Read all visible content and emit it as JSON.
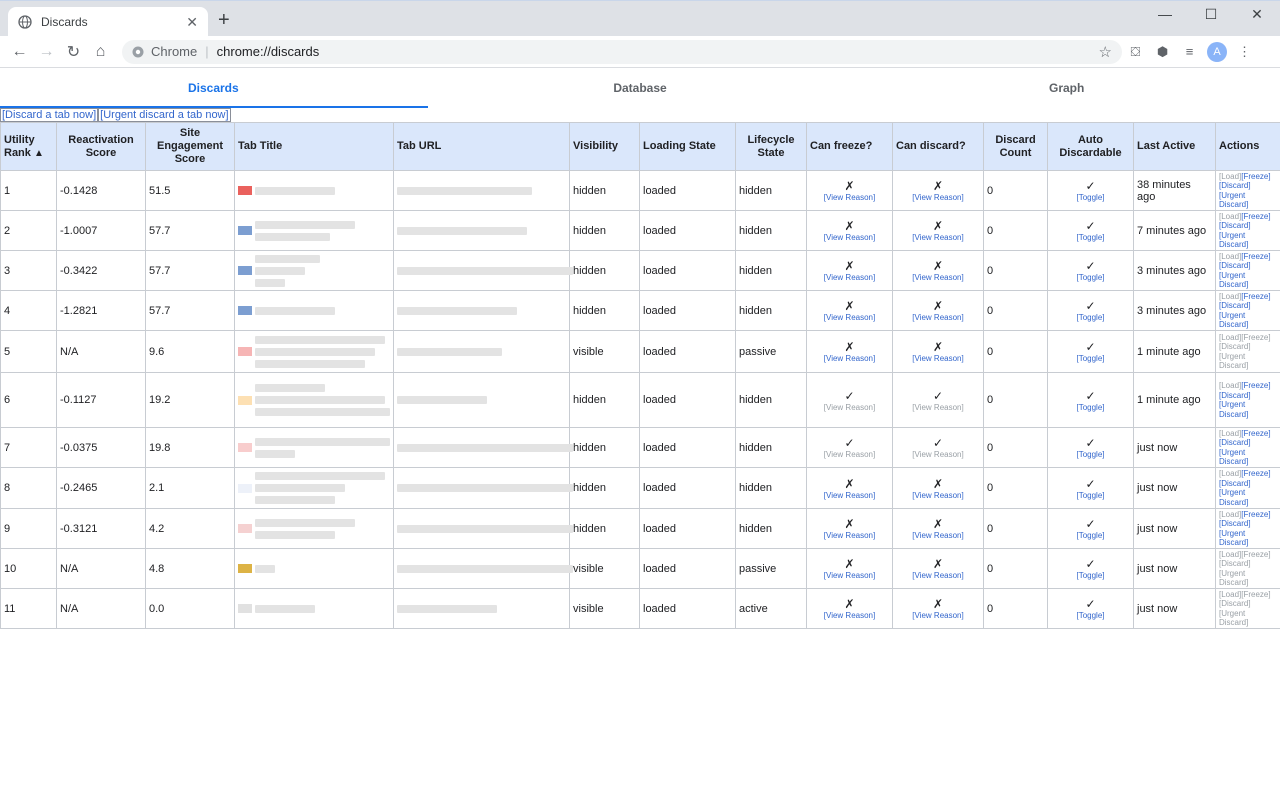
{
  "browser": {
    "tab_title": "Discards",
    "tab_close": "✕",
    "new_tab": "+",
    "window_controls": [
      "—",
      "☐",
      "✕"
    ],
    "omnibox": {
      "chip": "Chrome",
      "separator": "|",
      "url": "chrome://discards"
    },
    "profile_initial": "A"
  },
  "page_tabs": [
    {
      "label": "Discards",
      "active": true
    },
    {
      "label": "Database",
      "active": false
    },
    {
      "label": "Graph",
      "active": false
    }
  ],
  "action_links": {
    "discard": "[Discard a tab now]",
    "urgent": "[Urgent discard a tab now]"
  },
  "columns": [
    "Utility Rank",
    "Reactivation Score",
    "Site Engagement Score",
    "Tab Title",
    "Tab URL",
    "Visibility",
    "Loading State",
    "Lifecycle State",
    "Can freeze?",
    "Can discard?",
    "Discard Count",
    "Auto Discardable",
    "Last Active",
    "Actions"
  ],
  "sort_indicator": "▲",
  "labels": {
    "view_reason": "[View Reason]",
    "toggle": "[Toggle]",
    "load": "[Load]",
    "freeze": "[Freeze]",
    "discard": "[Discard]",
    "urgent": "[Urgent",
    "discard_close": "Discard]"
  },
  "rows": [
    {
      "rank": "1",
      "react": "-0.1428",
      "eng": "51.5",
      "vis": "hidden",
      "load": "loaded",
      "life": "hidden",
      "freeze": "✗",
      "freeze_vr_enabled": true,
      "discard": "✗",
      "discard_vr_enabled": true,
      "count": "0",
      "auto": "✓",
      "last": "38 minutes ago",
      "actions_enabled": true,
      "fav_color": "#e53935"
    },
    {
      "rank": "2",
      "react": "-1.0007",
      "eng": "57.7",
      "vis": "hidden",
      "load": "loaded",
      "life": "hidden",
      "freeze": "✗",
      "freeze_vr_enabled": true,
      "discard": "✗",
      "discard_vr_enabled": true,
      "count": "0",
      "auto": "✓",
      "last": "7 minutes ago",
      "actions_enabled": true,
      "fav_color": "#5b86c5"
    },
    {
      "rank": "3",
      "react": "-0.3422",
      "eng": "57.7",
      "vis": "hidden",
      "load": "loaded",
      "life": "hidden",
      "freeze": "✗",
      "freeze_vr_enabled": true,
      "discard": "✗",
      "discard_vr_enabled": true,
      "count": "0",
      "auto": "✓",
      "last": "3 minutes ago",
      "actions_enabled": true,
      "fav_color": "#5b86c5"
    },
    {
      "rank": "4",
      "react": "-1.2821",
      "eng": "57.7",
      "vis": "hidden",
      "load": "loaded",
      "life": "hidden",
      "freeze": "✗",
      "freeze_vr_enabled": true,
      "discard": "✗",
      "discard_vr_enabled": true,
      "count": "0",
      "auto": "✓",
      "last": "3 minutes ago",
      "actions_enabled": true,
      "fav_color": "#5b86c5"
    },
    {
      "rank": "5",
      "react": "N/A",
      "eng": "9.6",
      "vis": "visible",
      "load": "loaded",
      "life": "passive",
      "freeze": "✗",
      "freeze_vr_enabled": true,
      "discard": "✗",
      "discard_vr_enabled": true,
      "count": "0",
      "auto": "✓",
      "last": "1 minute ago",
      "actions_enabled": false,
      "fav_color": "#f4a3a3"
    },
    {
      "rank": "6",
      "react": "-0.1127",
      "eng": "19.2",
      "vis": "hidden",
      "load": "loaded",
      "life": "hidden",
      "freeze": "✓",
      "freeze_vr_enabled": false,
      "discard": "✓",
      "discard_vr_enabled": false,
      "count": "0",
      "auto": "✓",
      "last": "1 minute ago",
      "actions_enabled": true,
      "fav_color": "#fcd8a0"
    },
    {
      "rank": "7",
      "react": "-0.0375",
      "eng": "19.8",
      "vis": "hidden",
      "load": "loaded",
      "life": "hidden",
      "freeze": "✓",
      "freeze_vr_enabled": false,
      "discard": "✓",
      "discard_vr_enabled": false,
      "count": "0",
      "auto": "✓",
      "last": "just now",
      "actions_enabled": true,
      "fav_color": "#f6c1c1"
    },
    {
      "rank": "8",
      "react": "-0.2465",
      "eng": "2.1",
      "vis": "hidden",
      "load": "loaded",
      "life": "hidden",
      "freeze": "✗",
      "freeze_vr_enabled": true,
      "discard": "✗",
      "discard_vr_enabled": true,
      "count": "0",
      "auto": "✓",
      "last": "just now",
      "actions_enabled": true,
      "fav_color": "#e8eef7"
    },
    {
      "rank": "9",
      "react": "-0.3121",
      "eng": "4.2",
      "vis": "hidden",
      "load": "loaded",
      "life": "hidden",
      "freeze": "✗",
      "freeze_vr_enabled": true,
      "discard": "✗",
      "discard_vr_enabled": true,
      "count": "0",
      "auto": "✓",
      "last": "just now",
      "actions_enabled": true,
      "fav_color": "#f3c6c6"
    },
    {
      "rank": "10",
      "react": "N/A",
      "eng": "4.8",
      "vis": "visible",
      "load": "loaded",
      "life": "passive",
      "freeze": "✗",
      "freeze_vr_enabled": true,
      "discard": "✗",
      "discard_vr_enabled": true,
      "count": "0",
      "auto": "✓",
      "last": "just now",
      "actions_enabled": false,
      "fav_color": "#d4a017"
    },
    {
      "rank": "11",
      "react": "N/A",
      "eng": "0.0",
      "vis": "visible",
      "load": "loaded",
      "life": "active",
      "freeze": "✗",
      "freeze_vr_enabled": true,
      "discard": "✗",
      "discard_vr_enabled": true,
      "count": "0",
      "auto": "✓",
      "last": "just now",
      "actions_enabled": false,
      "fav_color": "#d9d9d9"
    }
  ]
}
